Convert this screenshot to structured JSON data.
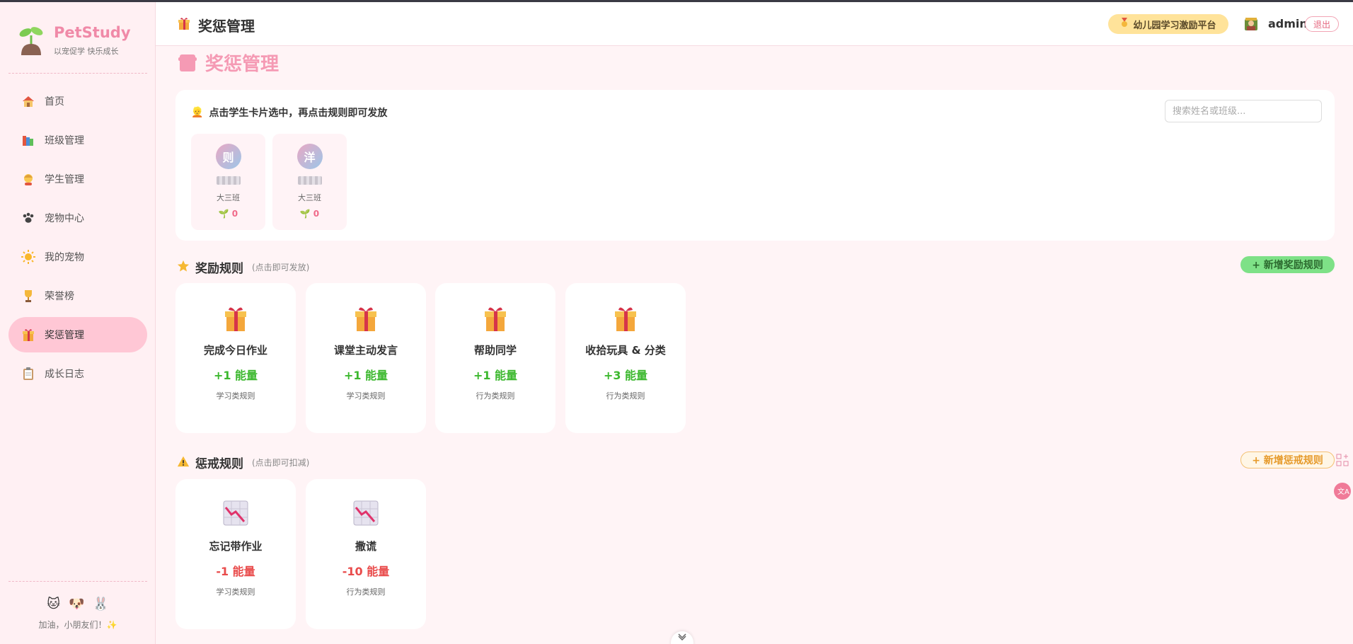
{
  "brand": {
    "name": "PetStudy",
    "tagline": "以宠促学 快乐成长"
  },
  "sidebar": {
    "items": [
      {
        "label": "首页",
        "icon": "house-icon"
      },
      {
        "label": "班级管理",
        "icon": "books-icon"
      },
      {
        "label": "学生管理",
        "icon": "child-icon"
      },
      {
        "label": "宠物中心",
        "icon": "paw-icon"
      },
      {
        "label": "我的宠物",
        "icon": "sun-icon"
      },
      {
        "label": "荣誉榜",
        "icon": "trophy-icon"
      },
      {
        "label": "奖惩管理",
        "icon": "gift-icon",
        "active": true
      },
      {
        "label": "成长日志",
        "icon": "clipboard-icon"
      }
    ],
    "footer_text": "加油，小朋友们！✨"
  },
  "header": {
    "title": "奖惩管理",
    "platform_badge": "幼儿园学习激励平台",
    "username": "admin",
    "logout_label": "退出"
  },
  "main": {
    "page_title": "奖惩管理",
    "hint": "点击学生卡片选中，再点击规则即可发放",
    "search_placeholder": "搜索姓名或班级...",
    "students": [
      {
        "initial": "则",
        "class_name": "大三班",
        "energy": "0"
      },
      {
        "initial": "洋",
        "class_name": "大三班",
        "energy": "0"
      }
    ],
    "reward_section": {
      "title": "奖励规则",
      "subtitle": "(点击即可发放)",
      "add_label": "+ 新增奖励规则",
      "rules": [
        {
          "name": "完成今日作业",
          "points": "+1 能量",
          "category": "学习类规则"
        },
        {
          "name": "课堂主动发言",
          "points": "+1 能量",
          "category": "学习类规则"
        },
        {
          "name": "帮助同学",
          "points": "+1 能量",
          "category": "行为类规则"
        },
        {
          "name": "收拾玩具 & 分类",
          "points": "+3 能量",
          "category": "行为类规则"
        }
      ]
    },
    "punish_section": {
      "title": "惩戒规则",
      "subtitle": "(点击即可扣减)",
      "add_label": "+ 新增惩戒规则",
      "rules": [
        {
          "name": "忘记带作业",
          "points": "-1 能量",
          "category": "学习类规则"
        },
        {
          "name": "撒谎",
          "points": "-10 能量",
          "category": "行为类规则"
        }
      ]
    }
  },
  "colors": {
    "brand_pink": "#f08aa8",
    "active_nav": "#ffc7d5",
    "reward_green": "#3cb82e",
    "punish_red": "#e94b4b",
    "add_reward_bg": "#7ee187"
  }
}
